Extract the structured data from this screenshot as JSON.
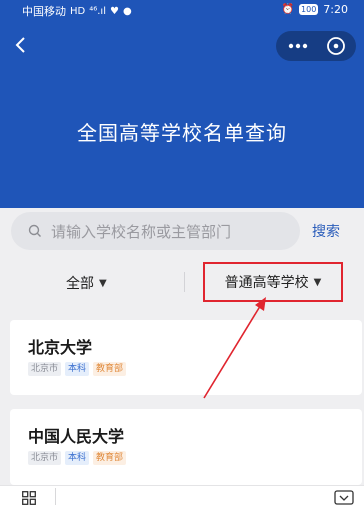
{
  "status_bar": {
    "carrier": "中国移动",
    "hd": "HD",
    "signal": "⁴⁶.ıl",
    "battery": "100",
    "time": "7:20"
  },
  "header": {
    "title": "全国高等学校名单查询"
  },
  "search": {
    "placeholder": "请输入学校名称或主管部门",
    "button_label": "搜索"
  },
  "filters": {
    "region": "全部",
    "type": "普通高等学校"
  },
  "schools": [
    {
      "name": "北京大学",
      "city": "北京市",
      "level": "本科",
      "department": "教育部"
    },
    {
      "name": "中国人民大学",
      "city": "北京市",
      "level": "本科",
      "department": "教育部"
    }
  ],
  "colors": {
    "header_blue": "#1f55b8",
    "highlight_red": "#e0252f",
    "link_blue": "#2a5cba"
  }
}
